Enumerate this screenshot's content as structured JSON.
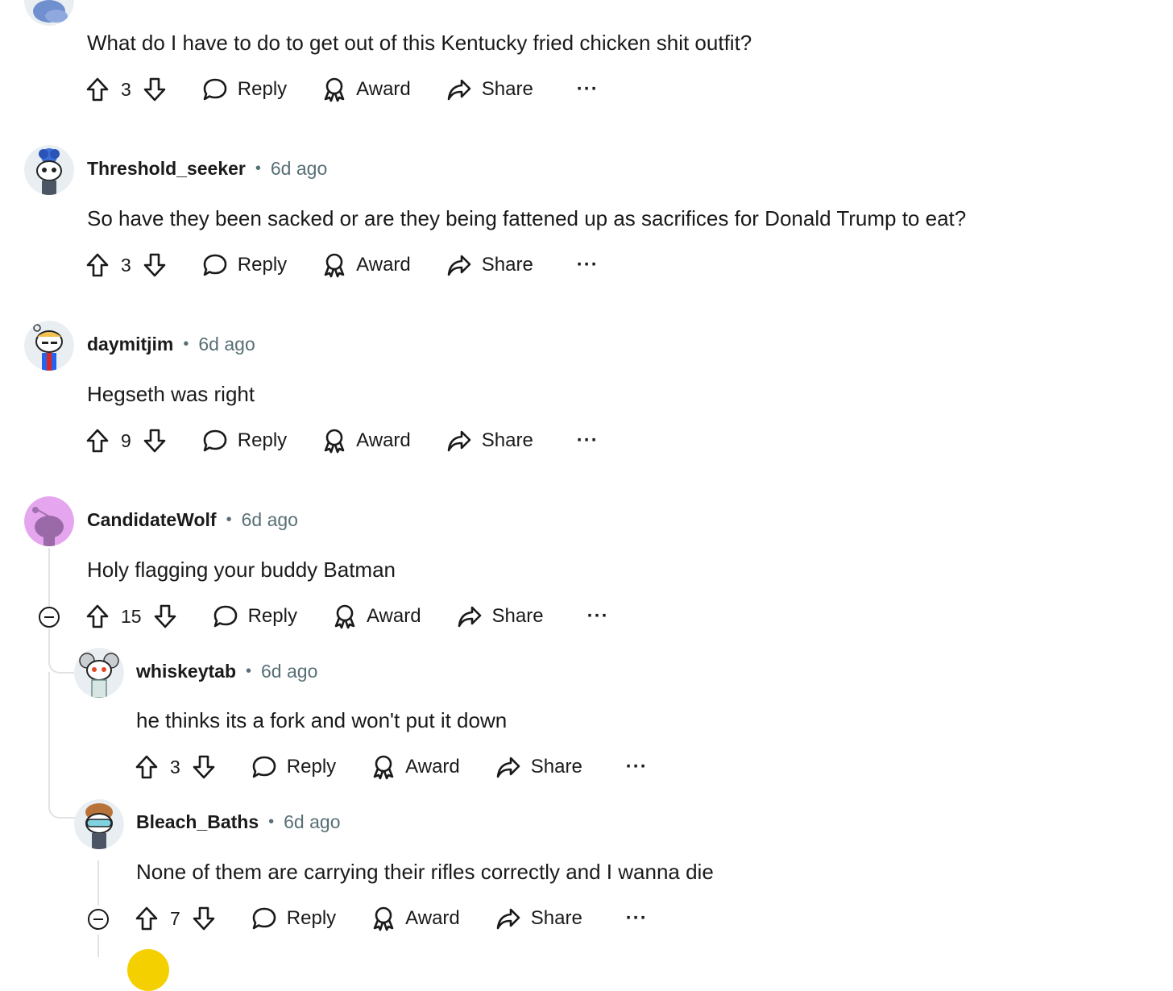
{
  "colors": {
    "text": "#1a1a1b",
    "meta": "#576f76",
    "thread": "#dfe3e6"
  },
  "actions": {
    "reply": "Reply",
    "award": "Award",
    "share": "Share",
    "more": "···"
  },
  "separator": "•",
  "comments": [
    {
      "username": "",
      "time": "",
      "text": "What do I have to do to get out of this Kentucky fried chicken shit outfit?",
      "votes": "3",
      "avatar": "snoo-avatar-blue"
    },
    {
      "username": "Threshold_seeker",
      "time": "6d ago",
      "text": "So have they been sacked or are they being fattened up as sacrifices for Donald Trump to eat?",
      "votes": "3",
      "avatar": "snoo-avatar-blue-hair"
    },
    {
      "username": "daymitjim",
      "time": "6d ago",
      "text": "Hegseth was right",
      "votes": "9",
      "avatar": "snoo-avatar-blonde"
    },
    {
      "username": "CandidateWolf",
      "time": "6d ago",
      "text": "Holy flagging your buddy Batman",
      "votes": "15",
      "avatar": "snoo-avatar-default-purple"
    },
    {
      "username": "whiskeytab",
      "time": "6d ago",
      "text": "he thinks its a fork and won't put it down",
      "votes": "3",
      "avatar": "snoo-avatar-koala"
    },
    {
      "username": "Bleach_Baths",
      "time": "6d ago",
      "text": "None of them are carrying their rifles correctly and I wanna die",
      "votes": "7",
      "avatar": "snoo-avatar-goggles"
    }
  ]
}
